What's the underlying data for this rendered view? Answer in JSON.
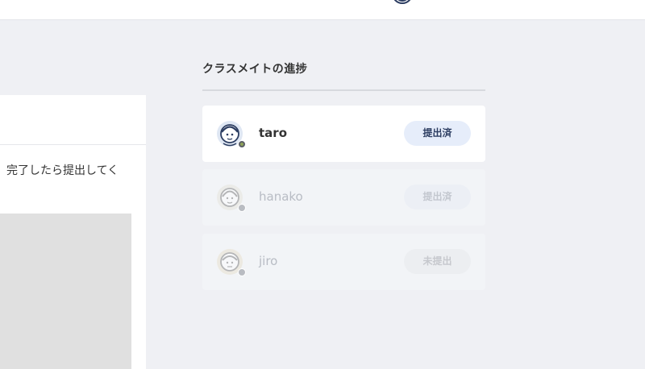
{
  "assignment": {
    "description": "完了したら提出してく"
  },
  "progress": {
    "title": "クラスメイトの進捗",
    "students": [
      {
        "name": "taro",
        "status": "提出済",
        "online": true
      },
      {
        "name": "hanako",
        "status": "提出済",
        "online": false
      },
      {
        "name": "jiro",
        "status": "未提出",
        "online": false
      }
    ]
  },
  "colors": {
    "badge_active_bg": "#e6edfa",
    "badge_active_text": "#2d3e62",
    "page_bg": "#eff0f4"
  }
}
